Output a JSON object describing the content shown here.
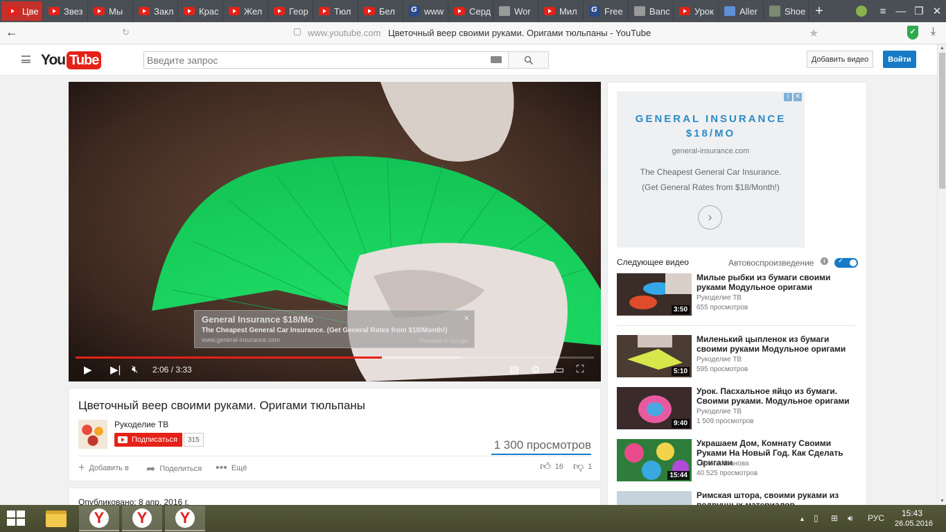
{
  "browser": {
    "tabs": [
      {
        "label": "Цве",
        "icon": "youtube-favicon",
        "active": true
      },
      {
        "label": "Звез",
        "icon": "youtube-favicon"
      },
      {
        "label": "Мы",
        "icon": "youtube-favicon"
      },
      {
        "label": "Закл",
        "icon": "youtube-favicon"
      },
      {
        "label": "Крас",
        "icon": "youtube-favicon"
      },
      {
        "label": "Жел",
        "icon": "youtube-favicon"
      },
      {
        "label": "Геор",
        "icon": "youtube-favicon"
      },
      {
        "label": "Тюл",
        "icon": "youtube-favicon"
      },
      {
        "label": "Бел",
        "icon": "youtube-favicon"
      },
      {
        "label": "www",
        "icon": "g-favicon"
      },
      {
        "label": "Серд",
        "icon": "youtube-favicon"
      },
      {
        "label": "Wor",
        "icon": "grey-favicon"
      },
      {
        "label": "Мил",
        "icon": "youtube-favicon"
      },
      {
        "label": "Free",
        "icon": "g-favicon"
      },
      {
        "label": "Banc",
        "icon": "grey-favicon"
      },
      {
        "label": "Урок",
        "icon": "youtube-favicon"
      },
      {
        "label": "Aller",
        "icon": "puzzle-favicon"
      },
      {
        "label": "Shoe",
        "icon": "shoe-favicon"
      }
    ],
    "new_tab": "+",
    "url_domain": "www.youtube.com",
    "page_title": "Цветочный веер своими руками. Оригами тюльпаны - YouTube"
  },
  "header": {
    "logo_you": "You",
    "logo_tube": "Tube",
    "search_placeholder": "Введите запрос",
    "upload_label": "Добавить видео",
    "signin_label": "Войти"
  },
  "player": {
    "overlay_ad": {
      "title": "General Insurance $18/Mo",
      "description": "The Cheapest General Car Insurance. (Get General Rates from $18/Month!)",
      "url": "www.general-insurance.com",
      "attribution": "Реклама от Google",
      "close": "×"
    },
    "current_time": "2:06",
    "duration": "3:33",
    "time_display": "2:06 / 3:33",
    "progress_fraction": 0.591,
    "muted": true
  },
  "video": {
    "title": "Цветочный веер своими руками. Оригами тюльпаны",
    "channel": "Рукоделие ТВ",
    "subscribe_label": "Подписаться",
    "subscriber_count": "315",
    "views": "1 300 просмотров",
    "actions": {
      "add_to": "Добавить в",
      "share": "Поделиться",
      "more": "Ещё"
    },
    "likes": "16",
    "dislikes": "1",
    "published": "Опубликовано: 8 апр. 2016 г."
  },
  "sidebar": {
    "ad": {
      "title": "GENERAL INSURANCE $18/MO",
      "domain": "general-insurance.com",
      "line1": "The Cheapest General Car Insurance.",
      "line2": "(Get General Rates from $18/Month!)"
    },
    "next_label": "Следующее видео",
    "autoplay_label": "Автовоспроизведение",
    "autoplay_on": true,
    "videos": [
      {
        "title": "Милые рыбки из бумаги своими руками Модульное оригами",
        "channel": "Рукоделие ТВ",
        "views": "655 просмотров",
        "duration": "3:50"
      },
      {
        "title": "Миленький цыпленок из бумаги своими руками Модульное оригами",
        "channel": "Рукоделие ТВ",
        "views": "595 просмотров",
        "duration": "5:10"
      },
      {
        "title": "Урок. Пасхальное яйцо из бумаги. Своими руками. Модульное оригами",
        "channel": "Рукоделие ТВ",
        "views": "1 509 просмотров",
        "duration": "9:40"
      },
      {
        "title": "Украшаем Дом, Комнату Своими Руками На Новый Год. Как Сделать Оригами",
        "channel": "Галина Иванова",
        "views": "40 525 просмотров",
        "duration": "15:44"
      },
      {
        "title": "Римская штора, своими руками из подручных материалов",
        "channel": "",
        "views": "",
        "duration": ""
      }
    ]
  },
  "taskbar": {
    "language": "РУС",
    "time": "15:43",
    "date": "26.05.2016"
  }
}
